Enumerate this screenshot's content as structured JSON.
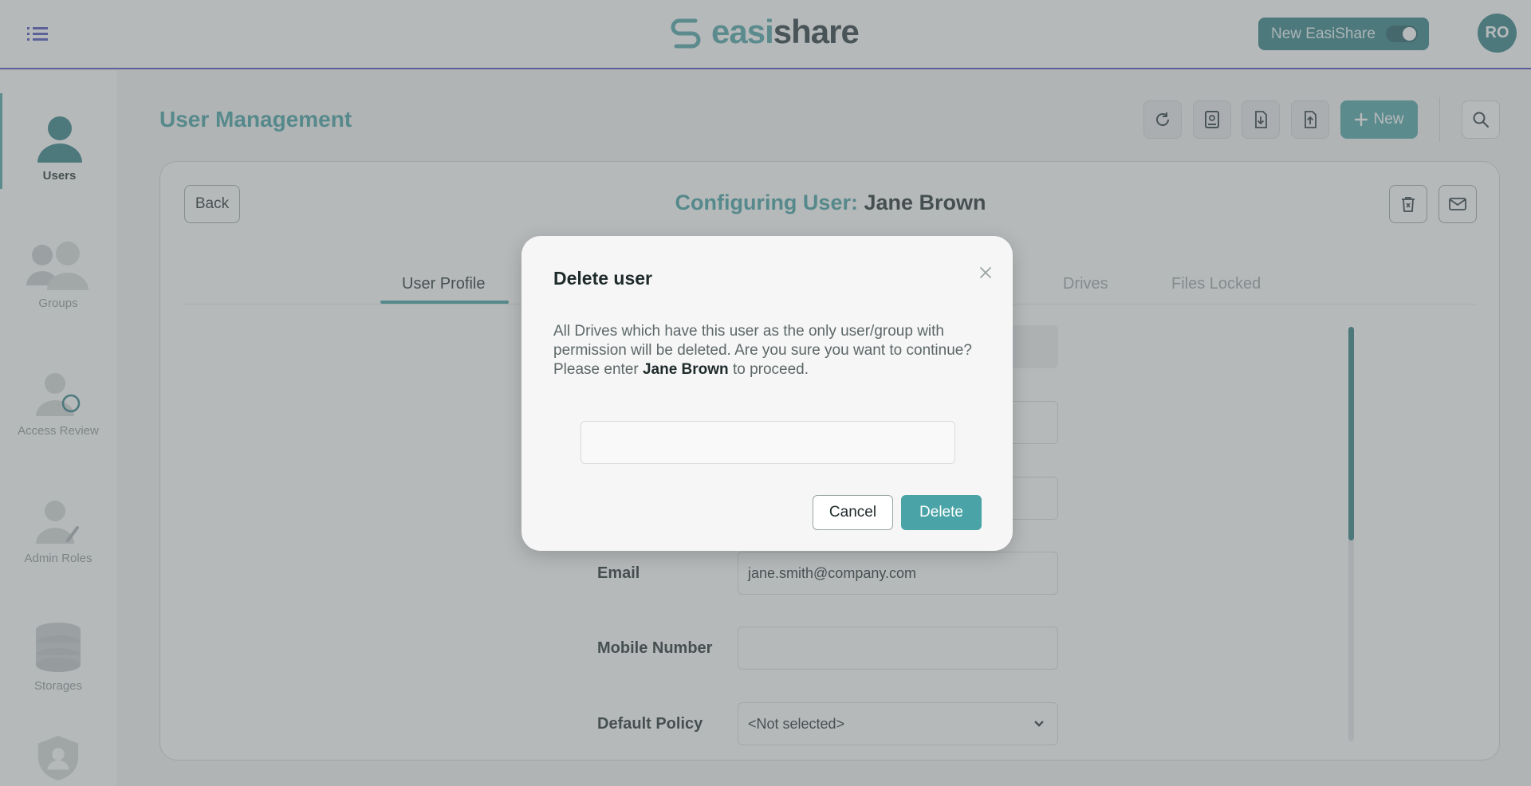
{
  "header": {
    "logo_prefix": "easi",
    "logo_suffix": "share",
    "toggle_label": "New EasiShare",
    "avatar_initials": "RO"
  },
  "sidebar": {
    "items": [
      {
        "label": "Users",
        "icon": "user-icon"
      },
      {
        "label": "Groups",
        "icon": "group-icon"
      },
      {
        "label": "Access Review",
        "icon": "access-review-icon"
      },
      {
        "label": "Admin Roles",
        "icon": "admin-role-icon"
      },
      {
        "label": "Storages",
        "icon": "storage-icon"
      }
    ]
  },
  "main": {
    "page_title": "User Management",
    "new_label": "New",
    "toolbar_icons": [
      "refresh-icon",
      "contacts-icon",
      "download-icon",
      "upload-icon",
      "search-icon"
    ]
  },
  "card": {
    "back_label": "Back",
    "title_label": "Configuring User:",
    "title_name": "Jane Brown",
    "tabs": [
      {
        "label": "User Profile",
        "active": true
      },
      {
        "label": "Drives",
        "active": false
      },
      {
        "label": "Files Locked",
        "active": false
      }
    ],
    "fields": {
      "email_label": "Email",
      "email_value": "jane.smith@company.com",
      "mobile_label": "Mobile Number",
      "mobile_value": "",
      "policy_label": "Default Policy",
      "policy_value": "<Not selected>"
    }
  },
  "modal": {
    "title": "Delete user",
    "message": "All Drives which have this user as the only user/group with permission will be deleted. Are you sure you want to continue?",
    "prompt_prefix": "Please enter",
    "prompt_name": "Jane Brown",
    "prompt_suffix": "to proceed.",
    "input_value": "",
    "cancel_label": "Cancel",
    "delete_label": "Delete"
  },
  "colors": {
    "accent": "#4aa3a6",
    "accent_dark": "#2d7f84",
    "header_border": "#4a4fbf"
  }
}
